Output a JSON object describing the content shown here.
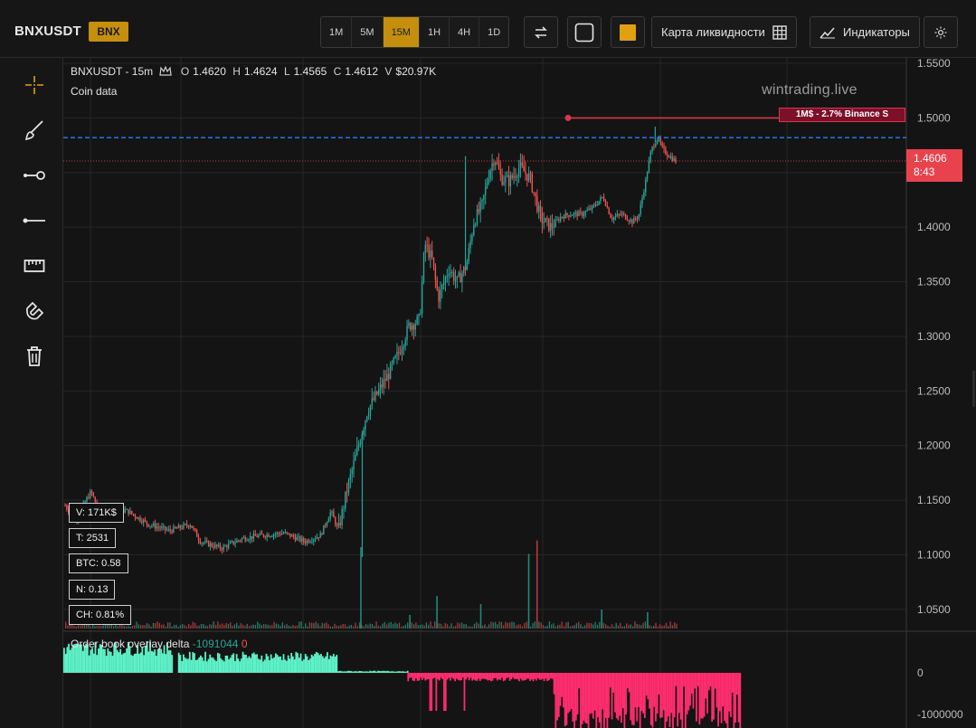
{
  "header": {
    "symbol": "BNXUSDT",
    "badge": "BNX",
    "timeframes": [
      "1M",
      "5M",
      "15M",
      "1H",
      "4H",
      "1D"
    ],
    "active_timeframe": "15M",
    "liquidity_map_label": "Карта ликвидности",
    "indicators_label": "Индикаторы",
    "icons": [
      "swap-arrows-icon",
      "square-outline-icon",
      "color-swatch-icon",
      "grid-icon",
      "chart-line-icon",
      "gear-icon"
    ],
    "swatch_color": "#e0a010"
  },
  "tools": [
    "crosshair-icon",
    "brush-icon",
    "ray-icon",
    "horizontal-line-icon",
    "ruler-icon",
    "magnet-icon",
    "trash-icon"
  ],
  "legend": {
    "pair": "BNXUSDT - 15m",
    "o_key": "O",
    "o": "1.4620",
    "h_key": "H",
    "h": "1.4624",
    "l_key": "L",
    "l": "1.4565",
    "c_key": "C",
    "c": "1.4612",
    "v_key": "V",
    "v": "$20.97K",
    "coin_data": "Coin data"
  },
  "watermark": "wintrading.live",
  "stats": {
    "v": "V: 171K$",
    "t": "T: 2531",
    "btc": "BTC: 0.58",
    "n": "N: 0.13",
    "ch": "CH: 0.81%"
  },
  "current_price": {
    "price": "1.4606",
    "countdown": "8:43"
  },
  "liquidity_level": {
    "label": "1M$ - 2.7% Binance S",
    "price": 1.5
  },
  "blue_level": 1.482,
  "orderbook": {
    "title": "Order book overlay delta",
    "value": "-1091044",
    "value2": "0",
    "ticks": [
      "0",
      "-1000000"
    ]
  },
  "colors": {
    "up": "#26a69a",
    "down": "#ef5350",
    "delta_pos": "#5ef2c8",
    "delta_neg": "#ff2d6f",
    "accent": "#c58f0d",
    "blue_line": "#2f7bff"
  },
  "chart_data": {
    "type": "candlestick",
    "y_ticks": [
      "1.5500",
      "1.5000",
      "1.4500",
      "1.4000",
      "1.3500",
      "1.3000",
      "1.2500",
      "1.2000",
      "1.1500",
      "1.1000",
      "1.0500"
    ],
    "ylim": [
      1.03,
      1.555
    ],
    "path": [
      [
        0,
        1.145
      ],
      [
        10,
        1.132
      ],
      [
        20,
        1.15
      ],
      [
        25,
        1.158
      ],
      [
        32,
        1.14
      ],
      [
        45,
        1.142
      ],
      [
        60,
        1.14
      ],
      [
        80,
        1.128
      ],
      [
        100,
        1.122
      ],
      [
        120,
        1.128
      ],
      [
        130,
        1.112
      ],
      [
        150,
        1.106
      ],
      [
        170,
        1.115
      ],
      [
        190,
        1.118
      ],
      [
        210,
        1.12
      ],
      [
        230,
        1.112
      ],
      [
        245,
        1.118
      ],
      [
        255,
        1.14
      ],
      [
        262,
        1.122
      ],
      [
        270,
        1.158
      ],
      [
        290,
        1.232
      ],
      [
        310,
        1.265
      ],
      [
        320,
        1.285
      ],
      [
        330,
        1.31
      ],
      [
        340,
        1.315
      ],
      [
        345,
        1.385
      ],
      [
        352,
        1.37
      ],
      [
        358,
        1.335
      ],
      [
        368,
        1.362
      ],
      [
        376,
        1.35
      ],
      [
        385,
        1.365
      ],
      [
        392,
        1.405
      ],
      [
        400,
        1.42
      ],
      [
        406,
        1.448
      ],
      [
        412,
        1.465
      ],
      [
        418,
        1.445
      ],
      [
        426,
        1.442
      ],
      [
        436,
        1.455
      ],
      [
        446,
        1.445
      ],
      [
        456,
        1.408
      ],
      [
        466,
        1.4
      ],
      [
        476,
        1.41
      ],
      [
        486,
        1.412
      ],
      [
        496,
        1.412
      ],
      [
        506,
        1.418
      ],
      [
        516,
        1.428
      ],
      [
        524,
        1.408
      ],
      [
        534,
        1.412
      ],
      [
        544,
        1.405
      ],
      [
        550,
        1.41
      ],
      [
        556,
        1.438
      ],
      [
        562,
        1.47
      ],
      [
        568,
        1.482
      ],
      [
        574,
        1.47
      ],
      [
        580,
        1.465
      ],
      [
        586,
        1.46
      ]
    ],
    "volume_spikes": [
      [
        283,
        0.6
      ],
      [
        356,
        0.24
      ],
      [
        444,
        0.55
      ],
      [
        452,
        0.65
      ],
      [
        514,
        0.14
      ],
      [
        558,
        0.12
      ],
      [
        330,
        0.1
      ],
      [
        398,
        0.18
      ]
    ],
    "delta_segments": [
      {
        "x": [
          0,
          105
        ],
        "sign": 1,
        "level": 0.45
      },
      {
        "x": [
          110,
          262
        ],
        "sign": 1,
        "level": 0.3
      },
      {
        "x": [
          262,
          330
        ],
        "sign": 1,
        "level": 0.03
      },
      {
        "x": [
          330,
          470
        ],
        "sign": -1,
        "level": 0.12
      },
      {
        "x": [
          470,
          650
        ],
        "sign": -1,
        "level": 0.85
      }
    ]
  }
}
